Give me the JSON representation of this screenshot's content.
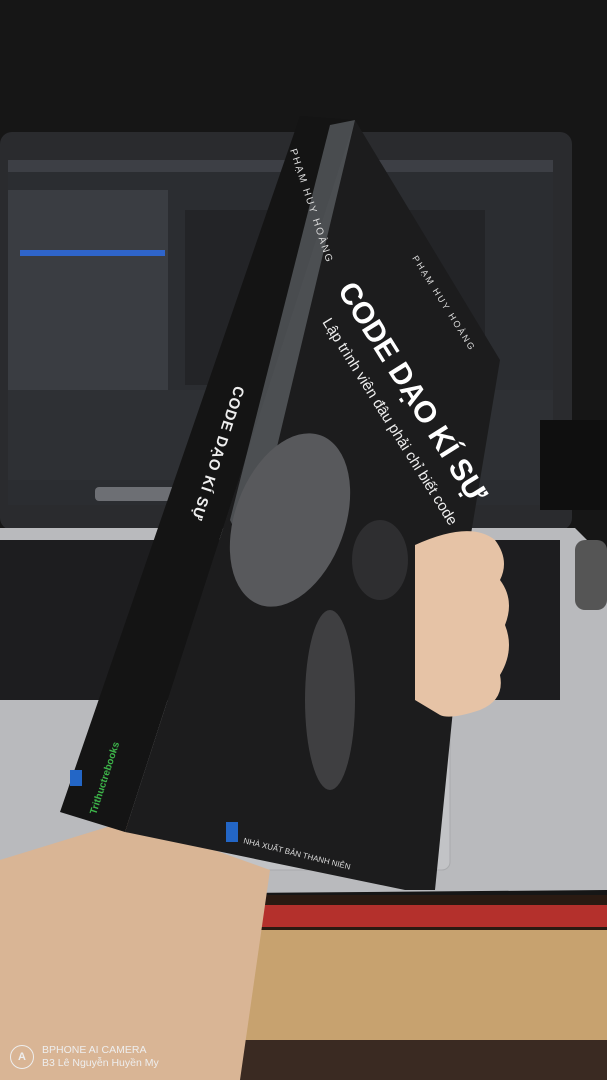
{
  "book": {
    "title": "CODE DẠO KÍ SỰ",
    "subtitle": "Lập trình viên đâu phải chỉ biết code",
    "author": "PHẠM HUY HOÀNG",
    "publisher": "NHÀ XUẤT BẢN THANH NIÊN",
    "imprint": "Trithuctrebooks"
  },
  "watermark": {
    "line1": "BPHONE AI CAMERA",
    "line2": "B3 Lê Nguyễn Huyền My"
  }
}
